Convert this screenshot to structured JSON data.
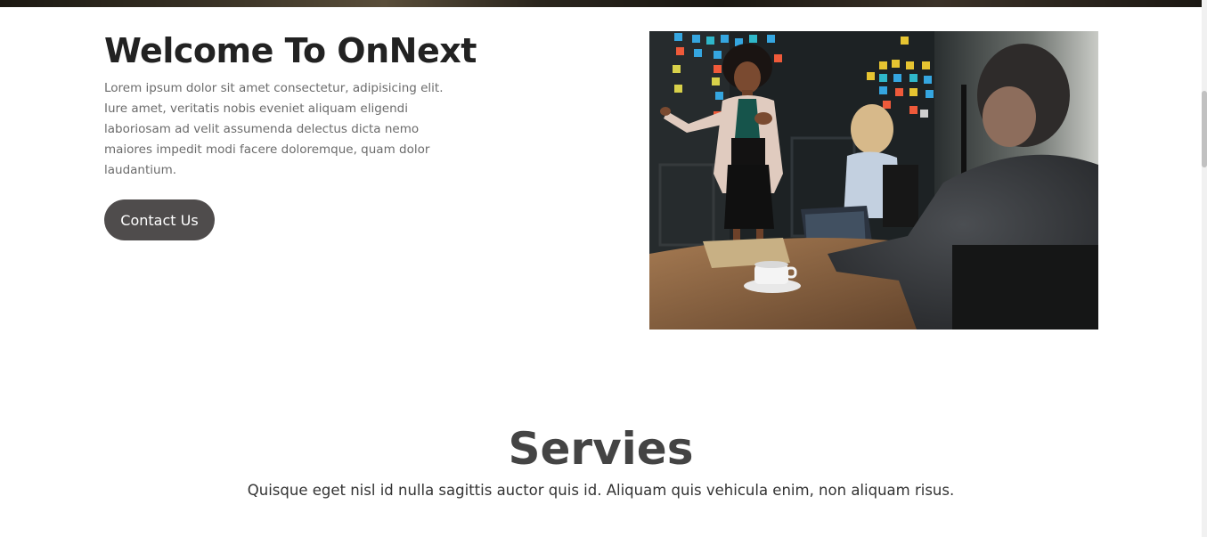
{
  "hero": {
    "title": "Welcome To OnNext",
    "text": "Lorem ipsum dolor sit amet consectetur, adipisicing elit. Iure amet, veritatis nobis eveniet aliquam eligendi laboriosam ad velit assumenda delectus dicta nemo maiores impedit modi facere doloremque, quam dolor laudantium.",
    "button_label": "Contact Us"
  },
  "services": {
    "title": "Servies",
    "subtitle": "Quisque eget nisl id nulla sagittis auctor quis id. Aliquam quis vehicula enim, non aliquam risus."
  },
  "colors": {
    "button_bg": "#4f4c4c",
    "title_text": "#222222",
    "body_text": "#6b6b6b",
    "section_title": "#444444"
  }
}
